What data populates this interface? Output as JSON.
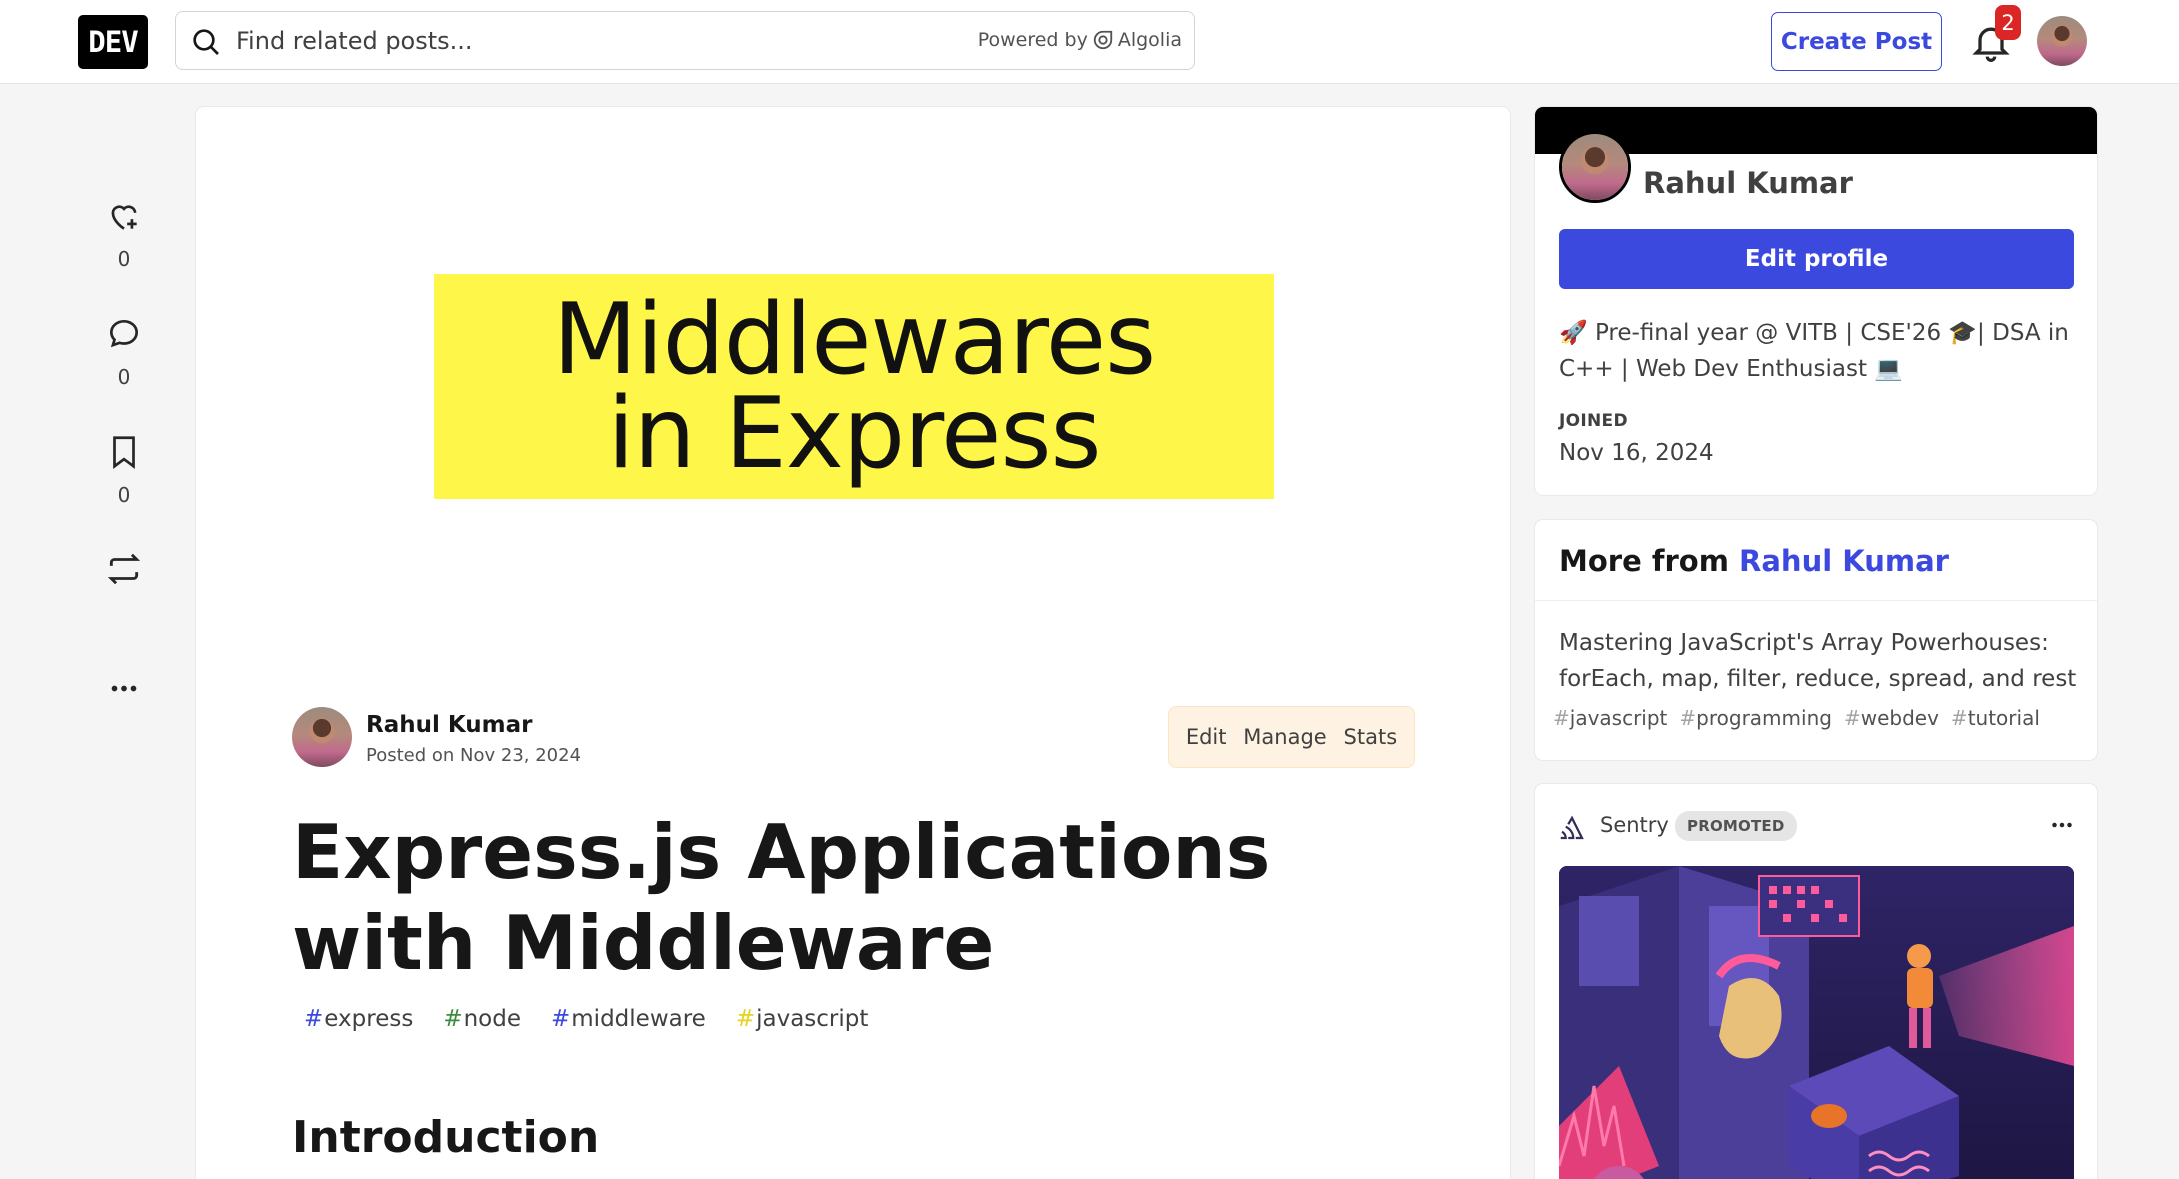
{
  "header": {
    "logo_text": "DEV",
    "search_placeholder": "Find related posts...",
    "powered_by": "Powered by",
    "algolia": "Algolia",
    "create_post": "Create Post",
    "notification_count": "2"
  },
  "rail": {
    "reactions": "0",
    "comments": "0",
    "bookmarks": "0"
  },
  "article": {
    "cover_line1": "Middlewares",
    "cover_line2": "in Express",
    "author": "Rahul Kumar",
    "posted": "Posted on Nov 23, 2024",
    "actions": [
      "Edit",
      "Manage",
      "Stats"
    ],
    "title": "Express.js Applications with Middleware",
    "tags": [
      {
        "name": "express",
        "hash_color": "#3b49df"
      },
      {
        "name": "node",
        "hash_color": "#3d8c40"
      },
      {
        "name": "middleware",
        "hash_color": "#3b49df"
      },
      {
        "name": "javascript",
        "hash_color": "#e6d31c"
      }
    ],
    "section_heading": "Introduction"
  },
  "profile": {
    "name": "Rahul Kumar",
    "edit_profile": "Edit profile",
    "bio": "🚀 Pre-final year @ VITB | CSE'26 🎓| DSA in C++ | Web Dev Enthusiast 💻",
    "joined_label": "JOINED",
    "joined_value": "Nov 16, 2024"
  },
  "more_from": {
    "prefix": "More from",
    "name": "Rahul Kumar",
    "post_title": "Mastering JavaScript's Array Powerhouses: forEach, map, filter, reduce, spread, and rest",
    "tags": [
      "javascript",
      "programming",
      "webdev",
      "tutorial"
    ]
  },
  "sponsor": {
    "name": "Sentry",
    "badge": "PROMOTED"
  },
  "colors": {
    "accent": "#3b49df",
    "cover_bg": "#fef749",
    "badge_red": "#dc2626"
  }
}
